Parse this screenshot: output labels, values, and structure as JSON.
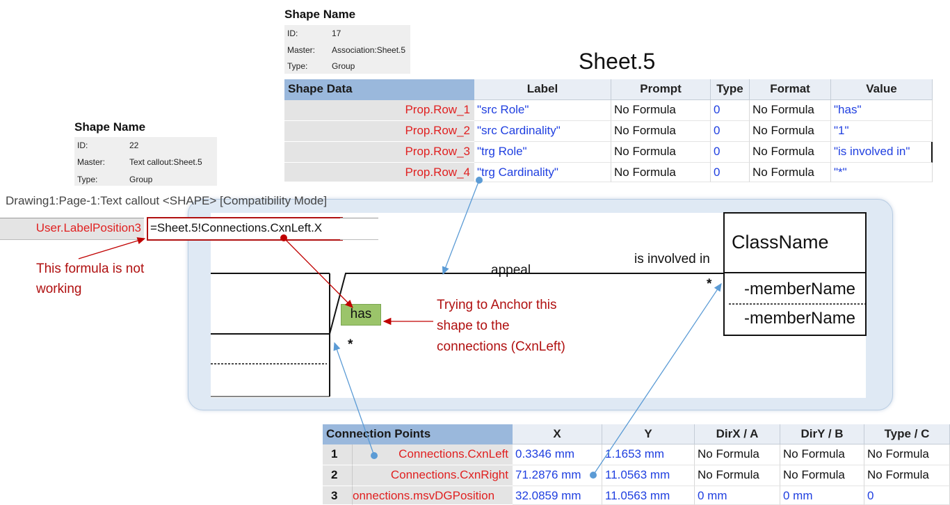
{
  "shape_info_top": {
    "title": "Shape Name",
    "rows": [
      {
        "key": "ID:",
        "value": "17"
      },
      {
        "key": "Master:",
        "value": "Association:Sheet.5"
      },
      {
        "key": "Type:",
        "value": "Group"
      }
    ]
  },
  "shape_info_left": {
    "title": "Shape Name",
    "rows": [
      {
        "key": "ID:",
        "value": "22"
      },
      {
        "key": "Master:",
        "value": "Text callout:Sheet.5"
      },
      {
        "key": "Type:",
        "value": "Group"
      }
    ]
  },
  "sheet_title": "Sheet.5",
  "shape_data": {
    "section": "Shape Data",
    "columns": [
      "Label",
      "Prompt",
      "Type",
      "Format",
      "Value"
    ],
    "rows": [
      {
        "name": "Prop.Row_1",
        "label": "\"src Role\"",
        "prompt": "No Formula",
        "type": "0",
        "format": "No Formula",
        "value": "\"has\""
      },
      {
        "name": "Prop.Row_2",
        "label": "\"src Cardinality\"",
        "prompt": "No Formula",
        "type": "0",
        "format": "No Formula",
        "value": "\"1\""
      },
      {
        "name": "Prop.Row_3",
        "label": "\"trg Role\"",
        "prompt": "No Formula",
        "type": "0",
        "format": "No Formula",
        "value": "\"is involved in\""
      },
      {
        "name": "Prop.Row_4",
        "label": "\"trg Cardinality\"",
        "prompt": "No Formula",
        "type": "0",
        "format": "No Formula",
        "value": "\"*\""
      }
    ]
  },
  "window_title": "Drawing1:Page-1:Text callout <SHAPE>  [Compatibility Mode]",
  "formula_row": {
    "name": "User.LabelPosition3",
    "formula": "=Sheet.5!Connections.CxnLeft.X"
  },
  "notes": {
    "formula_note_line1": "This formula is not",
    "formula_note_line2": "working",
    "anchor_note_line1": "Trying to Anchor this",
    "anchor_note_line2": "shape to the",
    "anchor_note_line3": "connections (CxnLeft)"
  },
  "diagram": {
    "class_name": "ClassName",
    "member1": "-memberName",
    "member2": "-memberName",
    "connector_label": "appeal",
    "target_role": "is involved in",
    "target_cardinality": "*",
    "source_role": "has",
    "source_cardinality": "*"
  },
  "connection_points": {
    "section": "Connection Points",
    "columns": [
      "X",
      "Y",
      "DirX / A",
      "DirY / B",
      "Type / C"
    ],
    "rows": [
      {
        "num": "1",
        "name": "Connections.CxnLeft",
        "x": "0.3346 mm",
        "y": "1.1653 mm",
        "dirx": "No Formula",
        "diry": "No Formula",
        "type": "No Formula"
      },
      {
        "num": "2",
        "name": "Connections.CxnRight",
        "x": "71.2876 mm",
        "y": "11.0563 mm",
        "dirx": "No Formula",
        "diry": "No Formula",
        "type": "No Formula"
      },
      {
        "num": "3",
        "name": "onnections.msvDGPosition",
        "x": "32.0859 mm",
        "y": "11.0563 mm",
        "dirx": "0 mm",
        "diry": "0 mm",
        "type": "0"
      }
    ]
  },
  "colors": {
    "red_text": "#e02020",
    "dark_red": "#b01010",
    "blue_value": "#1f3fe0",
    "header_blue": "#9ab8dc",
    "callout_green": "#9bc46a",
    "arrow_blue": "#5b9bd5"
  }
}
